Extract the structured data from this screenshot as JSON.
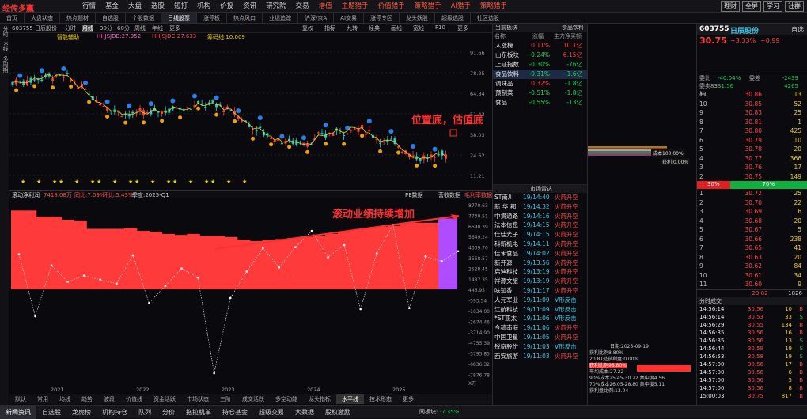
{
  "app": {
    "logo": "经传多赢",
    "badge": "官方"
  },
  "menu": [
    "行情",
    "基金",
    "大盘",
    "选股",
    "短打",
    "机构",
    "价投",
    "资讯",
    "研究院",
    "交易",
    "增值",
    "主题猎手",
    "价值猎手",
    "策略猎手",
    "AI猎手",
    "策略猎手"
  ],
  "top_right": [
    "理财",
    "全屏",
    "学习",
    "社群"
  ],
  "tabs": [
    "首页",
    "大盘状态",
    "热点题材",
    "自选股",
    "个股数据",
    "日线股票",
    "涨停板",
    "热点风口",
    "业绩追踪",
    "沪深/京A",
    "AI交易",
    "涨停专区",
    "龙头妖股",
    "超级选股",
    "社区选股"
  ],
  "sidebar": [
    "分时",
    "K线",
    "多周期"
  ],
  "chart_head": {
    "code": "603755 日辰股份",
    "periods": [
      "分时",
      "月线",
      "30分",
      "60分",
      "周线",
      "年线",
      "更多"
    ],
    "tools": [
      "复权",
      "指标",
      "九转",
      "经典",
      "画线",
      "宽线",
      "F10",
      "更多"
    ]
  },
  "info_line": {
    "a": "智能辅助",
    "b": "HHJSJDB:27.952",
    "c": "HHJSJDC:27.633",
    "d": "筹码线:10.009"
  },
  "y_axis_top": [
    "91.66",
    "78.25",
    "64.84",
    "51.43",
    "38.03",
    "24.62",
    "11.21"
  ],
  "annotation_top": "位置底，估值底",
  "annotation_bottom": "滚动业绩持续增加",
  "ind_head": {
    "a": "滚动净利润",
    "b": "7418.08万",
    "c": "同比:7.09%",
    "d": "环比:5.43%",
    "e": "季度:2025-Q1",
    "f": "PE数据",
    "g": "营收数据",
    "h": "毛利率数据"
  },
  "y_axis_bottom": [
    "8770.63",
    "7730.51",
    "6690.39",
    "5649.24",
    "4609.70",
    "3568.57",
    "2528.45",
    "1487.35",
    "446.95",
    "-593.54",
    "-1634.00",
    "-2674.46",
    "-3714.90",
    "-4755.39",
    "-5795.85",
    "-6836.32",
    "-7876.78"
  ],
  "y_unit": "X万",
  "years": [
    "2021",
    "2022",
    "2023",
    "2024",
    "2025"
  ],
  "bottom_tabs": [
    "默认",
    "常用",
    "均线",
    "趋势",
    "波段",
    "价值线",
    "资金活跃",
    "市场状态",
    "三阶",
    "成交活跃",
    "多空动能",
    "龙头指标",
    "水平线",
    "技术形态",
    "更多"
  ],
  "status_tabs": [
    "新闻资讯",
    "自选股",
    "龙虎榜",
    "机构持仓",
    "队列",
    "分价",
    "拖拉机单",
    "持仓基金",
    "超级交易",
    "大数据",
    "股权激励"
  ],
  "status_search": {
    "label": "同板块:",
    "value": "-7.35%"
  },
  "mid": {
    "header": {
      "title": "当前板块",
      "right": "食品饮料"
    },
    "cols": [
      "名称",
      "涨幅",
      "主力净买额"
    ],
    "rows": [
      {
        "n": "人涨榜",
        "p": "0.11%",
        "m": "10.1亿"
      },
      {
        "n": "山东板块",
        "p": "-0.24%",
        "m": "6.15亿"
      },
      {
        "n": "上证指数",
        "p": "-0.30%",
        "m": "-76亿"
      },
      {
        "n": "食品饮料",
        "p": "-0.31%",
        "m": "-1.6亿"
      },
      {
        "n": "调味品",
        "p": "0.32%",
        "m": "-1.8亿"
      },
      {
        "n": "预制菜",
        "p": "-0.51%",
        "m": "-1.8亿"
      },
      {
        "n": "食品",
        "p": "-0.55%",
        "m": "-13亿"
      }
    ],
    "news_title": "市场雷达",
    "news": [
      {
        "n": "ST南川",
        "t": "19/14:40",
        "e": "火箭升空"
      },
      {
        "n": "新 华 都",
        "t": "19/14:32",
        "e": "火箭升空"
      },
      {
        "n": "中贯通路",
        "t": "19/14:16",
        "e": "火箭升空"
      },
      {
        "n": "法本信息",
        "t": "19/14:15",
        "e": "火箭升空"
      },
      {
        "n": "仕佳光子",
        "t": "19/14:15",
        "e": "火箭升空"
      },
      {
        "n": "科新机电",
        "t": "19/14:11",
        "e": "火箭升空"
      },
      {
        "n": "佳禾食品",
        "t": "19/14:02",
        "e": "火箭升空"
      },
      {
        "n": "新开源",
        "t": "19/13:56",
        "e": "火箭升空"
      },
      {
        "n": "启迪科技",
        "t": "19/13:19",
        "e": "火箭升空"
      },
      {
        "n": "祥源文旅",
        "t": "19/13:19",
        "e": "火箭升空"
      },
      {
        "n": "味知香",
        "t": "19/11:17",
        "e": "火箭升空"
      },
      {
        "n": "人元军业",
        "t": "19/11:09",
        "e": "V形反击"
      },
      {
        "n": "江航科技",
        "t": "19/11:09",
        "e": "V形反击"
      },
      {
        "n": "*ST亚太",
        "t": "19/11:06",
        "e": "V形反击"
      },
      {
        "n": "今稿南海",
        "t": "19/11:06",
        "e": "火箭升空"
      },
      {
        "n": "中国卫星",
        "t": "19/11:05",
        "e": "火箭升空"
      },
      {
        "n": "锐奇股份",
        "t": "19/11:03",
        "e": "V形反击"
      },
      {
        "n": "西安旅游",
        "t": "19/11:03",
        "e": "火箭升空"
      }
    ]
  },
  "right": {
    "cost_date": "2025-09-19",
    "tag1": "获利比例8.80%",
    "tag2": "20.81处获利盘:0.00%",
    "tag3": "获利比例98.80%",
    "tag4": "平均成本:27.22",
    "tag5": "90%成本25.45-30.22 集中度4.56",
    "tag6": "70%成本26.05-28.80 集中度5.11",
    "tag7": "获利盘比例:13.04",
    "label1": "成本100.00%",
    "label2": "获利:0.00%"
  },
  "far": {
    "code": "603755",
    "name": "日辰股份",
    "search": "自选",
    "price": "30.75",
    "chg": "+3.33%",
    "chgv": "+0.99",
    "summary": [
      {
        "k": "委比",
        "v": "-40.04%",
        "k2": "委差",
        "v2": "-2439"
      },
      {
        "k": "委卖83档",
        "v": "31.56",
        "k2": "",
        "v2": "4265"
      }
    ],
    "asks": [
      [
        "11",
        "30.86",
        "13"
      ],
      [
        "10",
        "30.85",
        "52"
      ],
      [
        "9",
        "30.83",
        "25"
      ],
      [
        "8",
        "30.81",
        "1"
      ],
      [
        "7",
        "30.80",
        "425"
      ],
      [
        "6",
        "30.79",
        "10"
      ],
      [
        "5",
        "30.78",
        "20"
      ],
      [
        "4",
        "30.77",
        "366"
      ],
      [
        "3",
        "30.76",
        "17"
      ],
      [
        "2",
        "30.75",
        "149"
      ]
    ],
    "bar": {
      "l": "30%",
      "r": "70%"
    },
    "bids": [
      [
        "1",
        "30.72",
        "25"
      ],
      [
        "2",
        "30.70",
        "22"
      ],
      [
        "3",
        "30.69",
        "6"
      ],
      [
        "4",
        "30.68",
        "20"
      ],
      [
        "5",
        "30.67",
        "5"
      ],
      [
        "6",
        "30.66",
        "238"
      ],
      [
        "7",
        "30.65",
        "41"
      ],
      [
        "8",
        "30.63",
        "20"
      ],
      [
        "9",
        "30.62",
        "84"
      ],
      [
        "10",
        "30.61",
        "34"
      ],
      [
        "11",
        "30.60",
        "9"
      ]
    ],
    "bid_total": {
      "p": "29.82",
      "v": "1826"
    },
    "trades_title": "分时成交",
    "trades": [
      [
        "14:56:14",
        "30.56",
        "10",
        "B"
      ],
      [
        "14:56:14",
        "30.53",
        "33",
        "S"
      ],
      [
        "14:56:29",
        "30.55",
        "134",
        "B"
      ],
      [
        "14:56:35",
        "30.56",
        "16",
        "B"
      ],
      [
        "14:56:35",
        "30.56",
        "13",
        "S"
      ],
      [
        "14:56:44",
        "30.59",
        "19",
        "S"
      ],
      [
        "14:56:53",
        "30.58",
        "19",
        "S"
      ],
      [
        "14:57:00",
        "30.56",
        "17",
        "B"
      ],
      [
        "14:57:00",
        "30.56",
        "6",
        "B"
      ],
      [
        "14:57:00",
        "30.56",
        "5",
        "B"
      ],
      [
        "14:57:00",
        "30.56",
        "8",
        "B"
      ],
      [
        "15:00:03",
        "30.75",
        "817",
        "B"
      ]
    ]
  },
  "chart_data": {
    "type": "bar",
    "title": "滚动净利润",
    "ylim": [
      -7876.78,
      8770.63
    ],
    "values": [
      8200,
      8200,
      7600,
      7600,
      7300,
      7200,
      6400,
      6400,
      6400,
      6500,
      6200,
      6100,
      5900,
      5800,
      5900,
      5700,
      5700,
      5600,
      5300,
      5200,
      5300,
      5400,
      5500,
      5600,
      5700,
      5900,
      6100,
      6300,
      6500,
      6600,
      6700,
      7000,
      7000,
      7000
    ],
    "highlight_value": 7418,
    "line": [
      3900,
      -2200,
      2800,
      1200,
      1800,
      1400,
      1000,
      3800,
      -900,
      800,
      2500,
      1600,
      -7800,
      -400,
      2200,
      4500,
      2600,
      4600,
      6200,
      3600,
      4800,
      -1500,
      4000,
      6800,
      -1400,
      3700,
      3200,
      4200
    ]
  }
}
